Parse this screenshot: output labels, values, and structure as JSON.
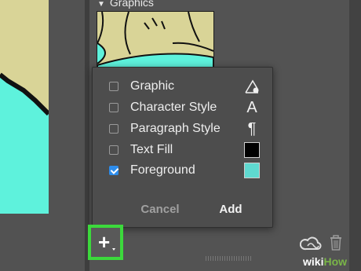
{
  "section": {
    "title": "Graphics",
    "toggle_icon": "disclosure-triangle-down"
  },
  "popup": {
    "items": [
      {
        "label": "Graphic",
        "checked": false,
        "icon": "graphic-shape-icon"
      },
      {
        "label": "Character Style",
        "checked": false,
        "icon_glyph": "A"
      },
      {
        "label": "Paragraph Style",
        "checked": false,
        "icon_glyph": "¶"
      },
      {
        "label": "Text Fill",
        "checked": false,
        "swatch_color": "#000000"
      },
      {
        "label": "Foreground",
        "checked": true,
        "swatch_color": "#5fd9d0"
      }
    ],
    "cancel_label": "Cancel",
    "add_label": "Add"
  },
  "toolbar": {
    "add_glyph": "+",
    "highlight_color": "#3cd93c",
    "icons": [
      "creative-cloud-icon",
      "trash-icon"
    ]
  },
  "watermark": {
    "part1": "wiki",
    "part2": "How"
  },
  "colors": {
    "accent": "#2d8ceb",
    "canvas_fill": "#d9d497",
    "shape_fill": "#5ef2dc"
  }
}
